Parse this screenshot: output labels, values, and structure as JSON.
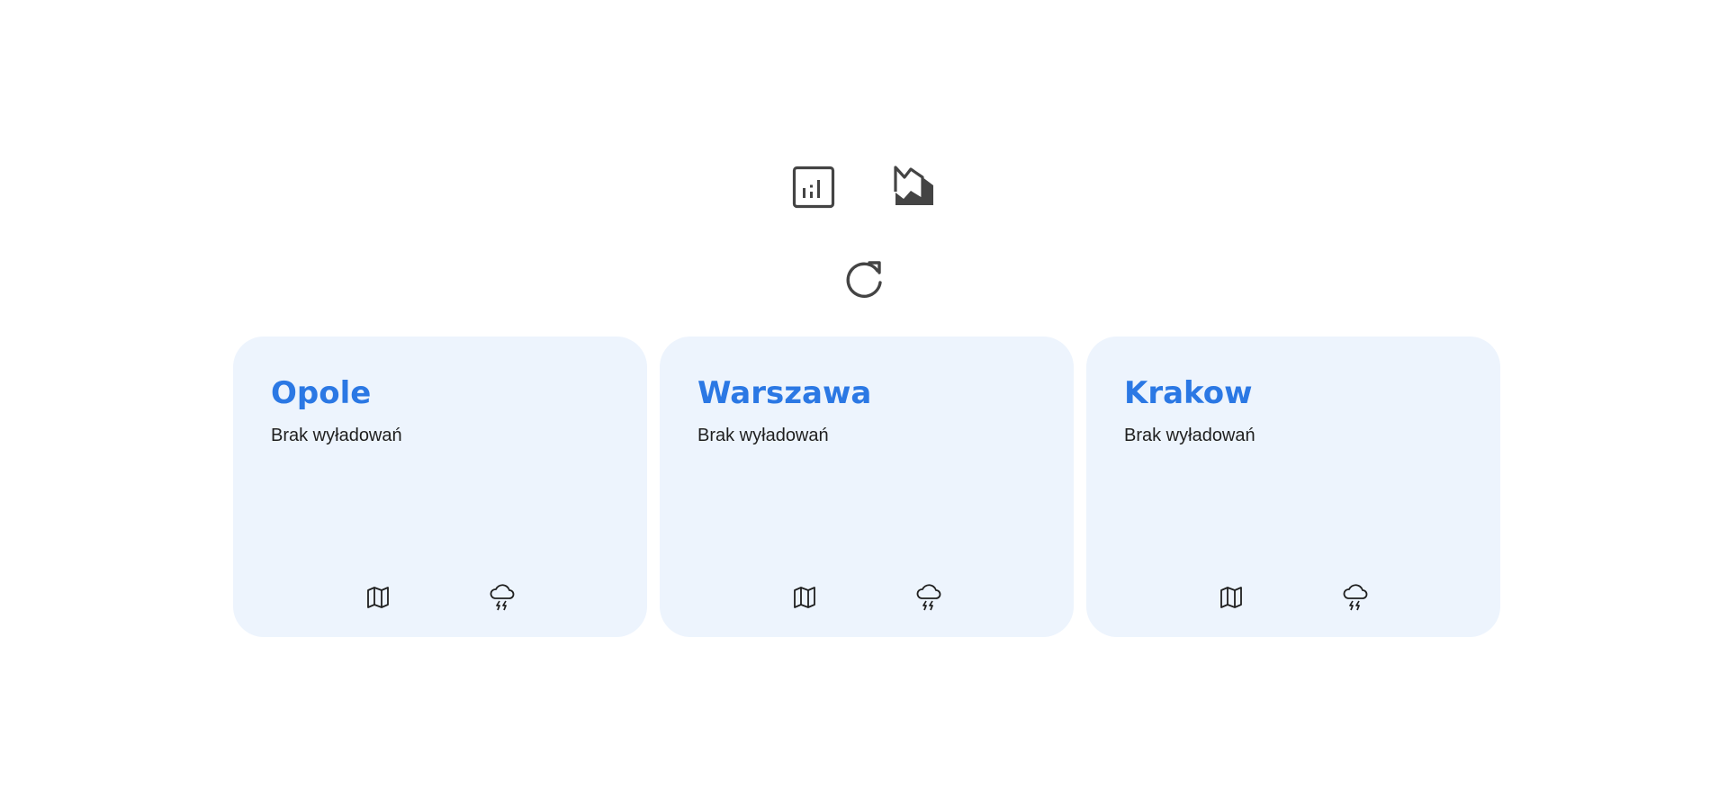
{
  "toolbar": {
    "icons": [
      "chart-report-icon",
      "mountain-landscape-icon",
      "refresh-icon"
    ],
    "icon_color": "#444444"
  },
  "cards": [
    {
      "title": "Opole",
      "status": "Brak wyładowań"
    },
    {
      "title": "Warszawa",
      "status": "Brak wyładowań"
    },
    {
      "title": "Krakow",
      "status": "Brak wyładowań"
    }
  ],
  "card_actions": [
    "map-icon",
    "thunderstorm-icon"
  ],
  "colors": {
    "card_background": "#edf4fd",
    "title": "#2b78e4",
    "status_text": "#1f1f1f"
  }
}
